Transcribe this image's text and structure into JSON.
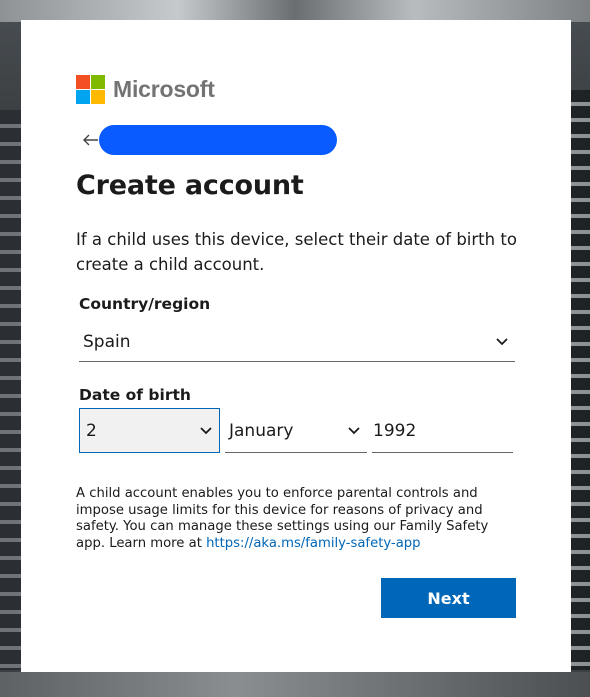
{
  "brand": {
    "name": "Microsoft",
    "colors": {
      "red": "#f25022",
      "green": "#7fba00",
      "blue": "#00a4ef",
      "yellow": "#ffb900"
    }
  },
  "header": {
    "back_icon": "back-arrow-icon",
    "identity_pill_color": "#0a5bff"
  },
  "page": {
    "title": "Create account",
    "description": "If a child uses this device, select their date of birth to create a child account."
  },
  "form": {
    "country": {
      "label": "Country/region",
      "value": "Spain"
    },
    "dob": {
      "label": "Date of birth",
      "day": "2",
      "month": "January",
      "year": "1992"
    }
  },
  "info": {
    "text": "A child account enables you to enforce parental controls and impose usage limits for this device for reasons of privacy and safety. You can manage these settings using our Family Safety app. Learn more at ",
    "link": "https://aka.ms/family-safety-app"
  },
  "actions": {
    "next_label": "Next",
    "accent": "#0067b8"
  }
}
